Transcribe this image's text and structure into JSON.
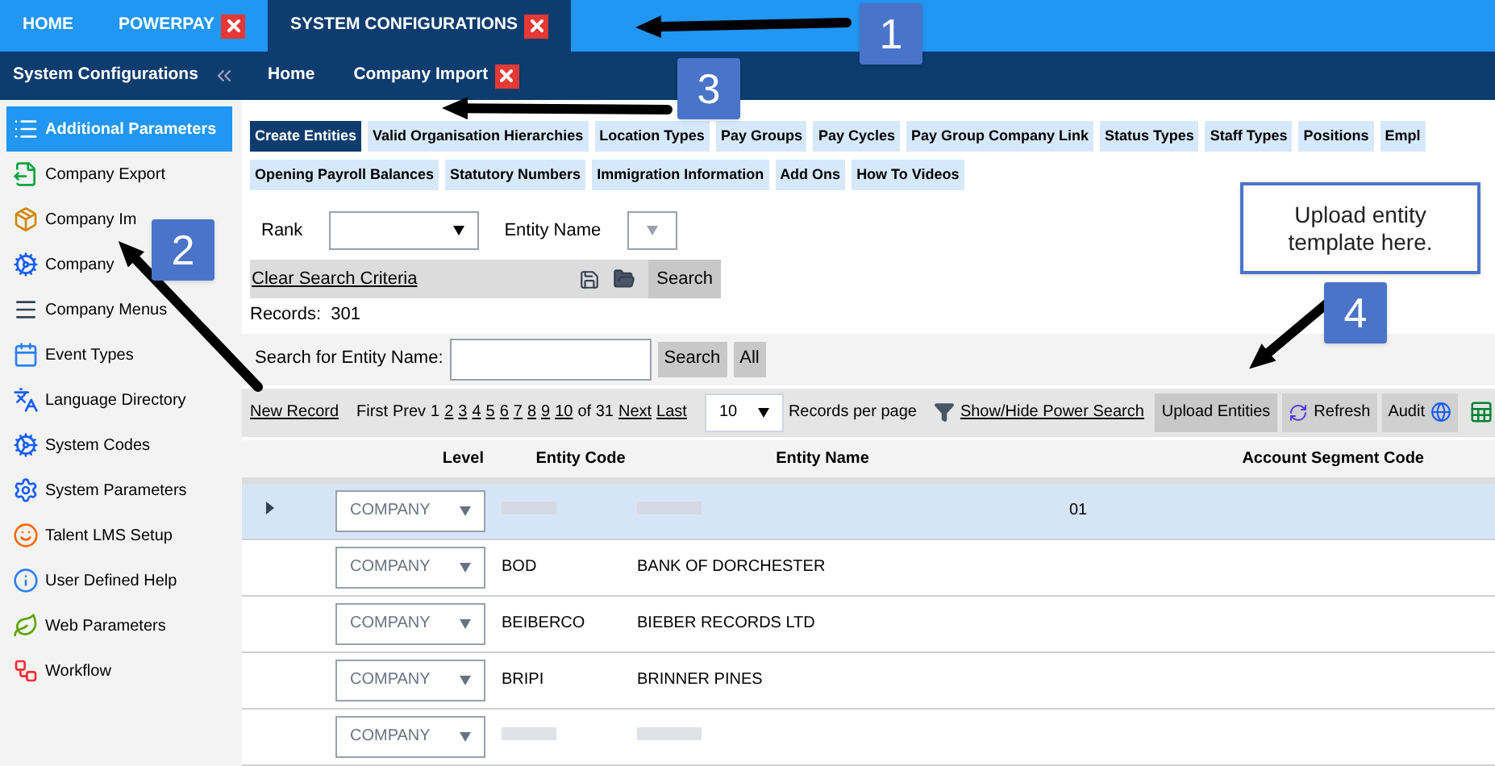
{
  "top_tabs": [
    {
      "label": "HOME",
      "selected": false,
      "closable": false
    },
    {
      "label": "POWERPAY",
      "selected": false,
      "closable": true
    },
    {
      "label": "SYSTEM CONFIGURATIONS",
      "selected": true,
      "closable": true
    }
  ],
  "sidebar": {
    "title": "System Configurations",
    "items": [
      {
        "label": "Additional Parameters",
        "selected": true
      },
      {
        "label": "Company Export",
        "selected": false
      },
      {
        "label": "Company Im",
        "selected": false
      },
      {
        "label": "Company",
        "selected": false
      },
      {
        "label": "Company Menus",
        "selected": false
      },
      {
        "label": "Event Types",
        "selected": false
      },
      {
        "label": "Language Directory",
        "selected": false
      },
      {
        "label": "System Codes",
        "selected": false
      },
      {
        "label": "System Parameters",
        "selected": false
      },
      {
        "label": "Talent LMS Setup",
        "selected": false
      },
      {
        "label": "User Defined Help",
        "selected": false
      },
      {
        "label": "Web Parameters",
        "selected": false
      },
      {
        "label": "Workflow",
        "selected": false
      }
    ]
  },
  "breadcrumb": [
    {
      "label": "Home",
      "closable": false
    },
    {
      "label": "Company Import",
      "closable": true
    }
  ],
  "sub_tab_rows": [
    [
      {
        "label": "Create Entities",
        "selected": true
      },
      {
        "label": "Valid Organisation Hierarchies",
        "selected": false
      },
      {
        "label": "Location Types",
        "selected": false
      },
      {
        "label": "Pay Groups",
        "selected": false
      },
      {
        "label": "Pay Cycles",
        "selected": false
      },
      {
        "label": "Pay Group Company Link",
        "selected": false
      },
      {
        "label": "Status Types",
        "selected": false
      },
      {
        "label": "Staff Types",
        "selected": false
      },
      {
        "label": "Positions",
        "selected": false
      },
      {
        "label": "Empl",
        "selected": false
      }
    ],
    [
      {
        "label": "Opening Payroll Balances",
        "selected": false
      },
      {
        "label": "Statutory Numbers",
        "selected": false
      },
      {
        "label": "Immigration Information",
        "selected": false
      },
      {
        "label": "Add Ons",
        "selected": false
      },
      {
        "label": "How To Videos",
        "selected": false
      }
    ]
  ],
  "filters": {
    "rank_label": "Rank",
    "entity_name_label": "Entity Name",
    "clear_link": "Clear Search Criteria",
    "search_button": "Search"
  },
  "records": {
    "label": "Records:",
    "value": "301"
  },
  "entity_search": {
    "label": "Search for Entity Name:",
    "buttons": [
      "Search",
      "All"
    ]
  },
  "pager": {
    "new_record": "New Record",
    "first": "First",
    "prev": "Prev",
    "pages": [
      {
        "label": "1",
        "selected": true
      },
      {
        "label": "2",
        "selected": false
      },
      {
        "label": "3",
        "selected": false
      },
      {
        "label": "4",
        "selected": false
      },
      {
        "label": "5",
        "selected": false
      },
      {
        "label": "6",
        "selected": false
      },
      {
        "label": "7",
        "selected": false
      },
      {
        "label": "8",
        "selected": false
      },
      {
        "label": "9",
        "selected": false
      },
      {
        "label": "10",
        "selected": false
      }
    ],
    "of_text": "of 31",
    "next": "Next",
    "last": "Last",
    "per_page": "10",
    "per_page_label": "Records per page",
    "power_search": "Show/Hide Power Search",
    "upload": "Upload Entities",
    "refresh": "Refresh",
    "audit": "Audit"
  },
  "table": {
    "columns": [
      "Level",
      "Entity Code",
      "Entity Name",
      "Account Segment Code"
    ],
    "rows": [
      {
        "selected": true,
        "redacted": true,
        "level": "COMPANY",
        "code": "",
        "name": "",
        "segment": "01"
      },
      {
        "selected": false,
        "redacted": false,
        "level": "COMPANY",
        "code": "BOD",
        "name": "BANK OF DORCHESTER",
        "segment": ""
      },
      {
        "selected": false,
        "redacted": false,
        "level": "COMPANY",
        "code": "BEIBERCO",
        "name": "BIEBER RECORDS LTD",
        "segment": ""
      },
      {
        "selected": false,
        "redacted": false,
        "level": "COMPANY",
        "code": "BRIPI",
        "name": "BRINNER PINES",
        "segment": ""
      },
      {
        "selected": false,
        "redacted": true,
        "level": "COMPANY",
        "code": "",
        "name": "",
        "segment": ""
      }
    ]
  },
  "annotations": {
    "badges": [
      "1",
      "2",
      "3",
      "4"
    ],
    "callout": "Upload entity template here."
  }
}
